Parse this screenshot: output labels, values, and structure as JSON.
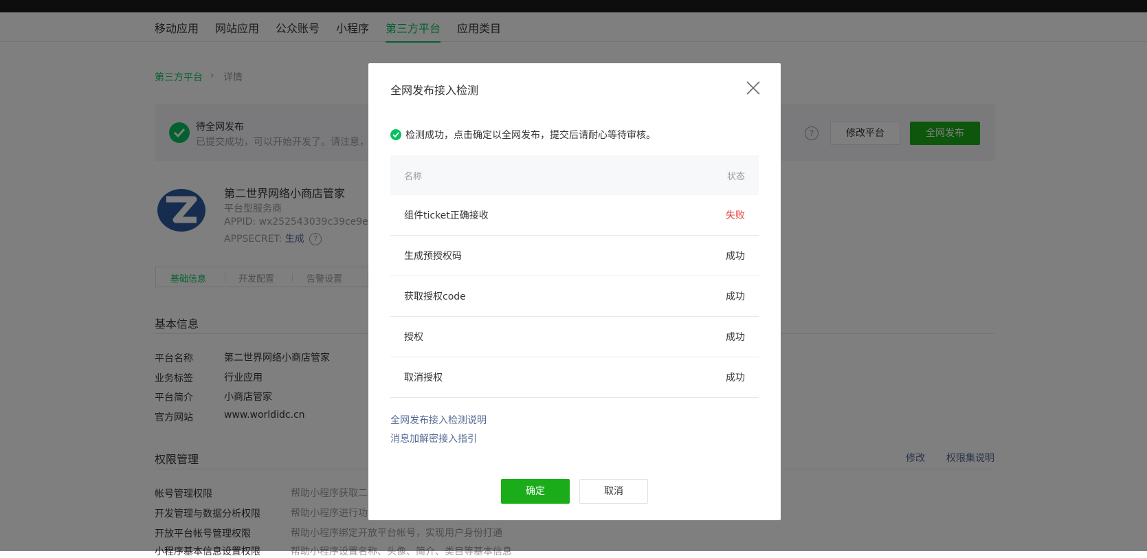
{
  "nav": {
    "items": [
      {
        "label": "移动应用"
      },
      {
        "label": "网站应用"
      },
      {
        "label": "公众账号"
      },
      {
        "label": "小程序"
      },
      {
        "label": "第三方平台",
        "active": true
      },
      {
        "label": "应用类目"
      }
    ]
  },
  "breadcrumb": {
    "root": "第三方平台",
    "separator": "›",
    "current": "详情"
  },
  "status": {
    "title": "待全网发布",
    "desc": "已提交成功，可以开始开发了。请注意，",
    "help": "?",
    "edit_button": "修改平台",
    "publish_button": "全网发布"
  },
  "app": {
    "name": "第二世界网络小商店管家",
    "type": "平台型服务商",
    "appid": "APPID: wx252543039c39ce9e",
    "secret_label": "APPSECRET:",
    "secret_link": "生成",
    "secret_help": "?"
  },
  "subtabs": [
    {
      "label": "基础信息",
      "active": true
    },
    {
      "label": "开发配置"
    },
    {
      "label": "告警设置"
    }
  ],
  "basic_info": {
    "title": "基本信息",
    "rows": [
      {
        "label": "平台名称",
        "value": "第二世界网络小商店管家"
      },
      {
        "label": "业务标签",
        "value": "行业应用"
      },
      {
        "label": "平台简介",
        "value": "小商店管家"
      },
      {
        "label": "官方网站",
        "value": "www.worldidc.cn"
      }
    ]
  },
  "permissions": {
    "title": "权限管理",
    "edit_link": "修改",
    "doc_link": "权限集说明",
    "rows": [
      {
        "label": "帐号管理权限",
        "desc": "帮助小程序获取二"
      },
      {
        "label": "开发管理与数据分析权限",
        "desc": "帮助小程序进行功"
      },
      {
        "label": "开放平台帐号管理权限",
        "desc": "帮助小程序绑定开放平台帐号，实现用户身份打通"
      },
      {
        "label": "小程序基本信息设置权限",
        "desc": "帮助小程序设置名称、头像、简介、类目等基本信息"
      }
    ]
  },
  "dialog": {
    "title": "全网发布接入检测",
    "success_msg": "检测成功，点击确定以全网发布，提交后请耐心等待审核。",
    "table": {
      "col_name": "名称",
      "col_status": "状态",
      "rows": [
        {
          "name": "组件ticket正确接收",
          "status": "失败",
          "fail": true
        },
        {
          "name": "生成预授权码",
          "status": "成功"
        },
        {
          "name": "获取授权code",
          "status": "成功"
        },
        {
          "name": "授权",
          "status": "成功"
        },
        {
          "name": "取消授权",
          "status": "成功"
        }
      ]
    },
    "link_check_doc": "全网发布接入检测说明",
    "link_encrypt_doc": "消息加解密接入指引",
    "confirm": "确定",
    "cancel": "取消"
  },
  "colors": {
    "brand_green": "#07c160",
    "button_green": "#1aad19",
    "link_blue": "#576b95",
    "fail_red": "#e64340"
  }
}
